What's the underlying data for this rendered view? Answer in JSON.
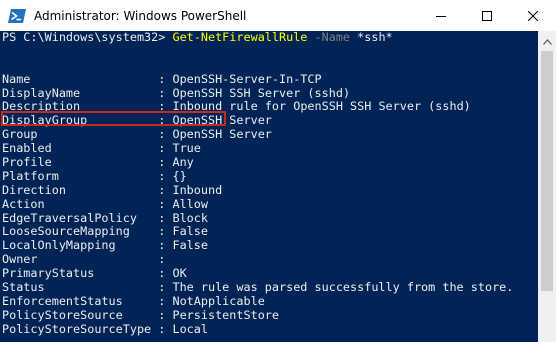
{
  "window": {
    "title": "Administrator: Windows PowerShell",
    "icon": "powershell-icon",
    "controls": [
      "minimize-icon",
      "maximize-icon",
      "close-icon"
    ]
  },
  "colors": {
    "console_bg": "#012456",
    "console_fg": "#eeedf0",
    "command": "#ffff00",
    "parameter": "#808080",
    "highlight": "#c42b1c"
  },
  "console": {
    "prompt": "PS C:\\Windows\\system32> ",
    "command": "Get-NetFirewallRule",
    "parameter": " -Name",
    "argument": " *ssh*",
    "properties": [
      {
        "name": "Name",
        "value": "OpenSSH-Server-In-TCP"
      },
      {
        "name": "DisplayName",
        "value": "OpenSSH SSH Server (sshd)"
      },
      {
        "name": "Description",
        "value": "Inbound rule for OpenSSH SSH Server (sshd)"
      },
      {
        "name": "DisplayGroup",
        "value": "OpenSSH Server"
      },
      {
        "name": "Group",
        "value": "OpenSSH Server"
      },
      {
        "name": "Enabled",
        "value": "True"
      },
      {
        "name": "Profile",
        "value": "Any"
      },
      {
        "name": "Platform",
        "value": "{}"
      },
      {
        "name": "Direction",
        "value": "Inbound"
      },
      {
        "name": "Action",
        "value": "Allow"
      },
      {
        "name": "EdgeTraversalPolicy",
        "value": "Block"
      },
      {
        "name": "LooseSourceMapping",
        "value": "False"
      },
      {
        "name": "LocalOnlyMapping",
        "value": "False"
      },
      {
        "name": "Owner",
        "value": ""
      },
      {
        "name": "PrimaryStatus",
        "value": "OK"
      },
      {
        "name": "Status",
        "value": "The rule was parsed successfully from the store."
      },
      {
        "name": "EnforcementStatus",
        "value": "NotApplicable"
      },
      {
        "name": "PolicyStoreSource",
        "value": "PersistentStore"
      },
      {
        "name": "PolicyStoreSourceType",
        "value": "Local"
      }
    ]
  }
}
